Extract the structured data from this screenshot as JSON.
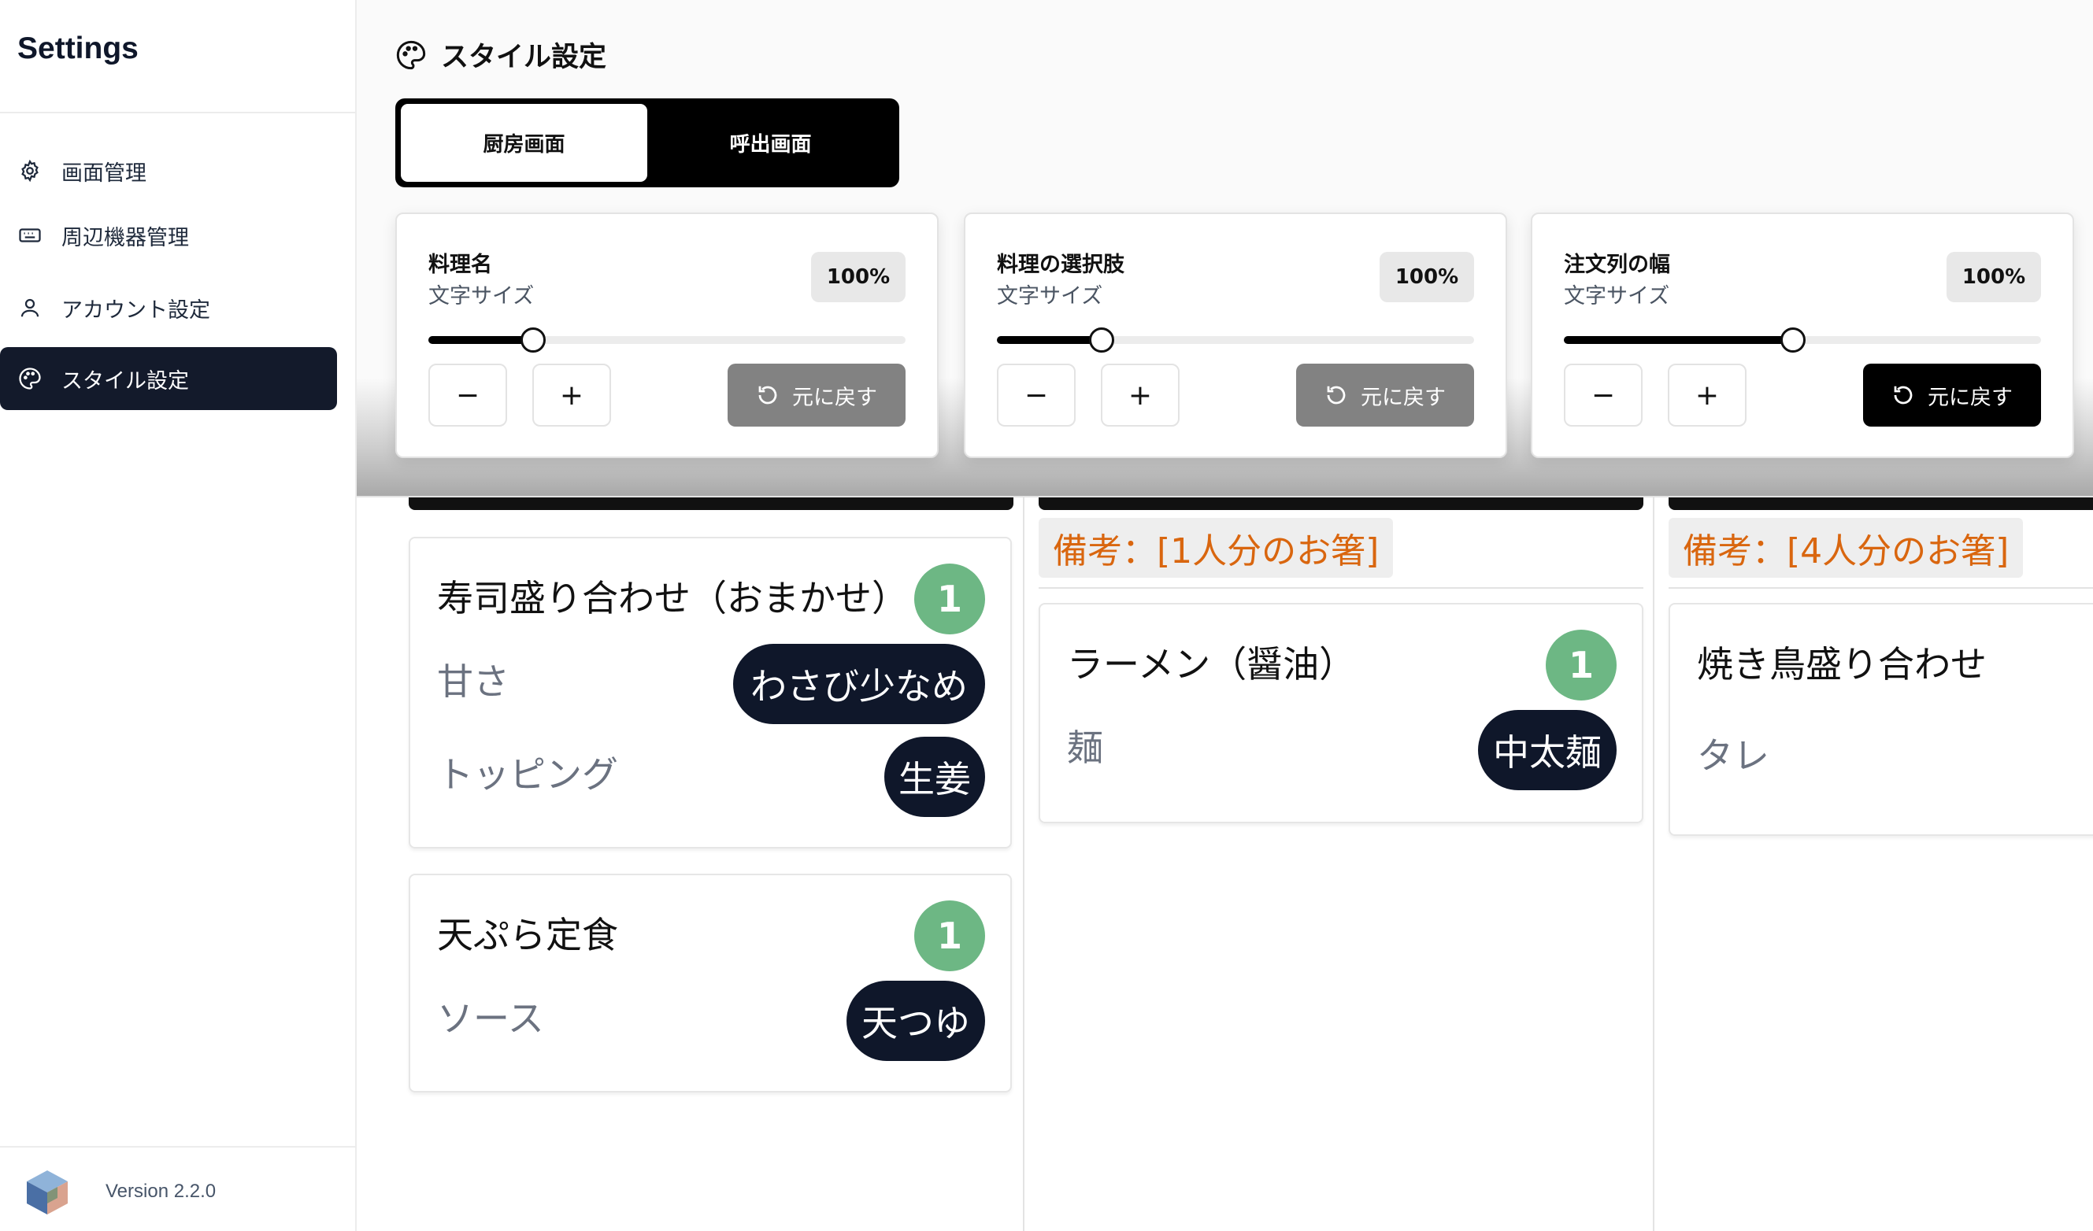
{
  "sidebar": {
    "title": "Settings",
    "items": [
      {
        "label": "画面管理",
        "icon": "gear-icon"
      },
      {
        "label": "周辺機器管理",
        "icon": "keyboard-icon"
      },
      {
        "label": "アカウント設定",
        "icon": "user-icon"
      },
      {
        "label": "スタイル設定",
        "icon": "palette-icon",
        "active": true
      }
    ],
    "version": "Version 2.2.0"
  },
  "header": {
    "title": "スタイル設定",
    "icon": "palette-icon"
  },
  "tabs": [
    {
      "label": "厨房画面",
      "active": true
    },
    {
      "label": "呼出画面",
      "active": false
    }
  ],
  "cards": [
    {
      "title": "料理名",
      "subtitle": "文字サイズ",
      "percent": "100%",
      "slider_value": 0.22,
      "minus": "−",
      "plus": "+",
      "reset_label": "元に戻す",
      "reset_enabled": false
    },
    {
      "title": "料理の選択肢",
      "subtitle": "文字サイズ",
      "percent": "100%",
      "slider_value": 0.22,
      "minus": "−",
      "plus": "+",
      "reset_label": "元に戻す",
      "reset_enabled": false
    },
    {
      "title": "注文列の幅",
      "subtitle": "文字サイズ",
      "percent": "100%",
      "slider_value": 0.48,
      "minus": "−",
      "plus": "+",
      "reset_label": "元に戻す",
      "reset_enabled": true
    }
  ],
  "preview": {
    "columns": [
      {
        "note": "",
        "dishes": [
          {
            "name": "寿司盛り合わせ（おまかせ）",
            "qty": "1",
            "options": [
              {
                "label": "甘さ",
                "value": "わさび少なめ"
              },
              {
                "label": "トッピング",
                "value": "生姜"
              }
            ]
          },
          {
            "name": "天ぷら定食",
            "qty": "1",
            "options": [
              {
                "label": "ソース",
                "value": "天つゆ"
              }
            ]
          }
        ]
      },
      {
        "note": "備考：[1人分のお箸]",
        "dishes": [
          {
            "name": "ラーメン（醤油）",
            "qty": "1",
            "options": [
              {
                "label": "麺",
                "value": "中太麺"
              }
            ]
          }
        ]
      },
      {
        "note": "備考：[4人分のお箸]",
        "dishes": [
          {
            "name": "焼き鳥盛り合わせ",
            "qty": "",
            "options": [
              {
                "label": "タレ",
                "value": ""
              }
            ]
          }
        ]
      }
    ]
  },
  "colors": {
    "sidebar_active_bg": "#131a2b",
    "qty_badge": "#6db784",
    "note_text": "#d9660f",
    "pill_bg": "#0f172a",
    "reset_disabled": "#828282",
    "reset_enabled": "#000000"
  }
}
